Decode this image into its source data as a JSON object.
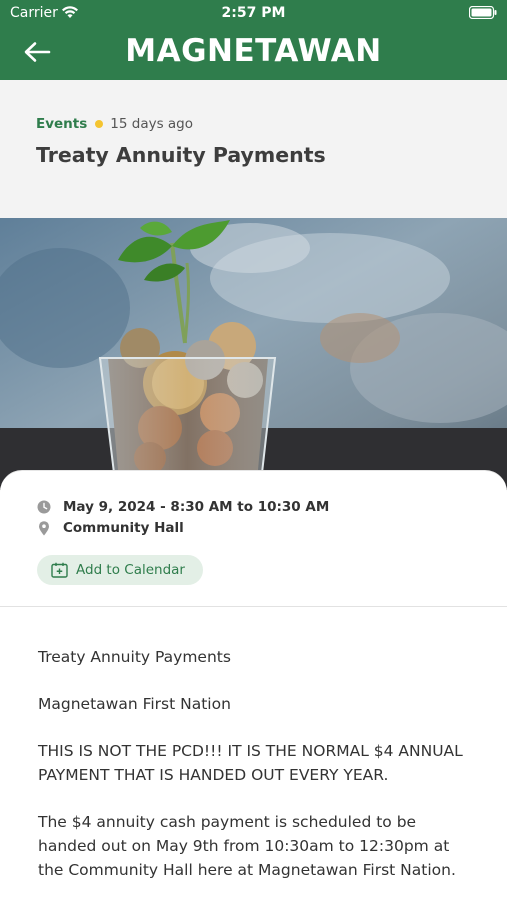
{
  "status_bar": {
    "carrier": "Carrier",
    "time": "2:57 PM"
  },
  "header": {
    "brand": "MAGNETAWAN",
    "accent_color": "#2f7d4c"
  },
  "post": {
    "category": "Events",
    "posted_ago": "15 days ago",
    "title": "Treaty Annuity Payments"
  },
  "event": {
    "datetime": "May 9, 2024 - 8:30 AM to 10:30 AM",
    "location": "Community Hall",
    "calendar_label": "Add to Calendar"
  },
  "body": {
    "paragraphs": [
      "Treaty Annuity Payments",
      "Magnetawan First Nation",
      "THIS IS NOT THE PCD!!! IT IS THE NORMAL $4 ANNUAL PAYMENT THAT IS HANDED OUT EVERY YEAR.",
      "The $4 annuity cash payment is scheduled to be handed out on May 9th from 10:30am to 12:30pm at the Community Hall here at Magnetawan First Nation."
    ]
  },
  "icons": [
    "wifi-icon",
    "battery-icon",
    "back-arrow-icon",
    "clock-icon",
    "location-pin-icon",
    "calendar-plus-icon"
  ]
}
